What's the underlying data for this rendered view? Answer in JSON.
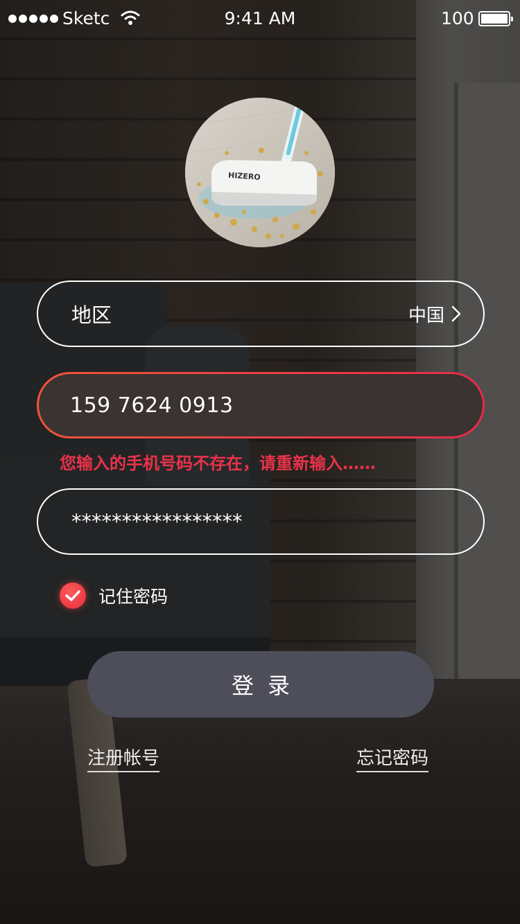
{
  "status_bar": {
    "carrier": "Sketc",
    "time": "9:41 AM",
    "battery_percent": "100",
    "signal_icon": "signal-dots-icon",
    "wifi_icon": "wifi-icon",
    "battery_icon": "battery-icon"
  },
  "avatar": {
    "brand_text": "HIZERO"
  },
  "form": {
    "region": {
      "label": "地区",
      "value": "中国",
      "icon": "chevron-right-icon"
    },
    "phone": {
      "value": "159 7624 0913",
      "border_color": "#e9334a"
    },
    "error_message": "您输入的手机号码不存在，请重新输入……",
    "password": {
      "value": "*****************"
    },
    "remember": {
      "label": "记住密码",
      "checked": true,
      "accent_color": "#e52c3a"
    },
    "login_button": "登录"
  },
  "links": {
    "register": "注册帐号",
    "forgot": "忘记密码"
  }
}
